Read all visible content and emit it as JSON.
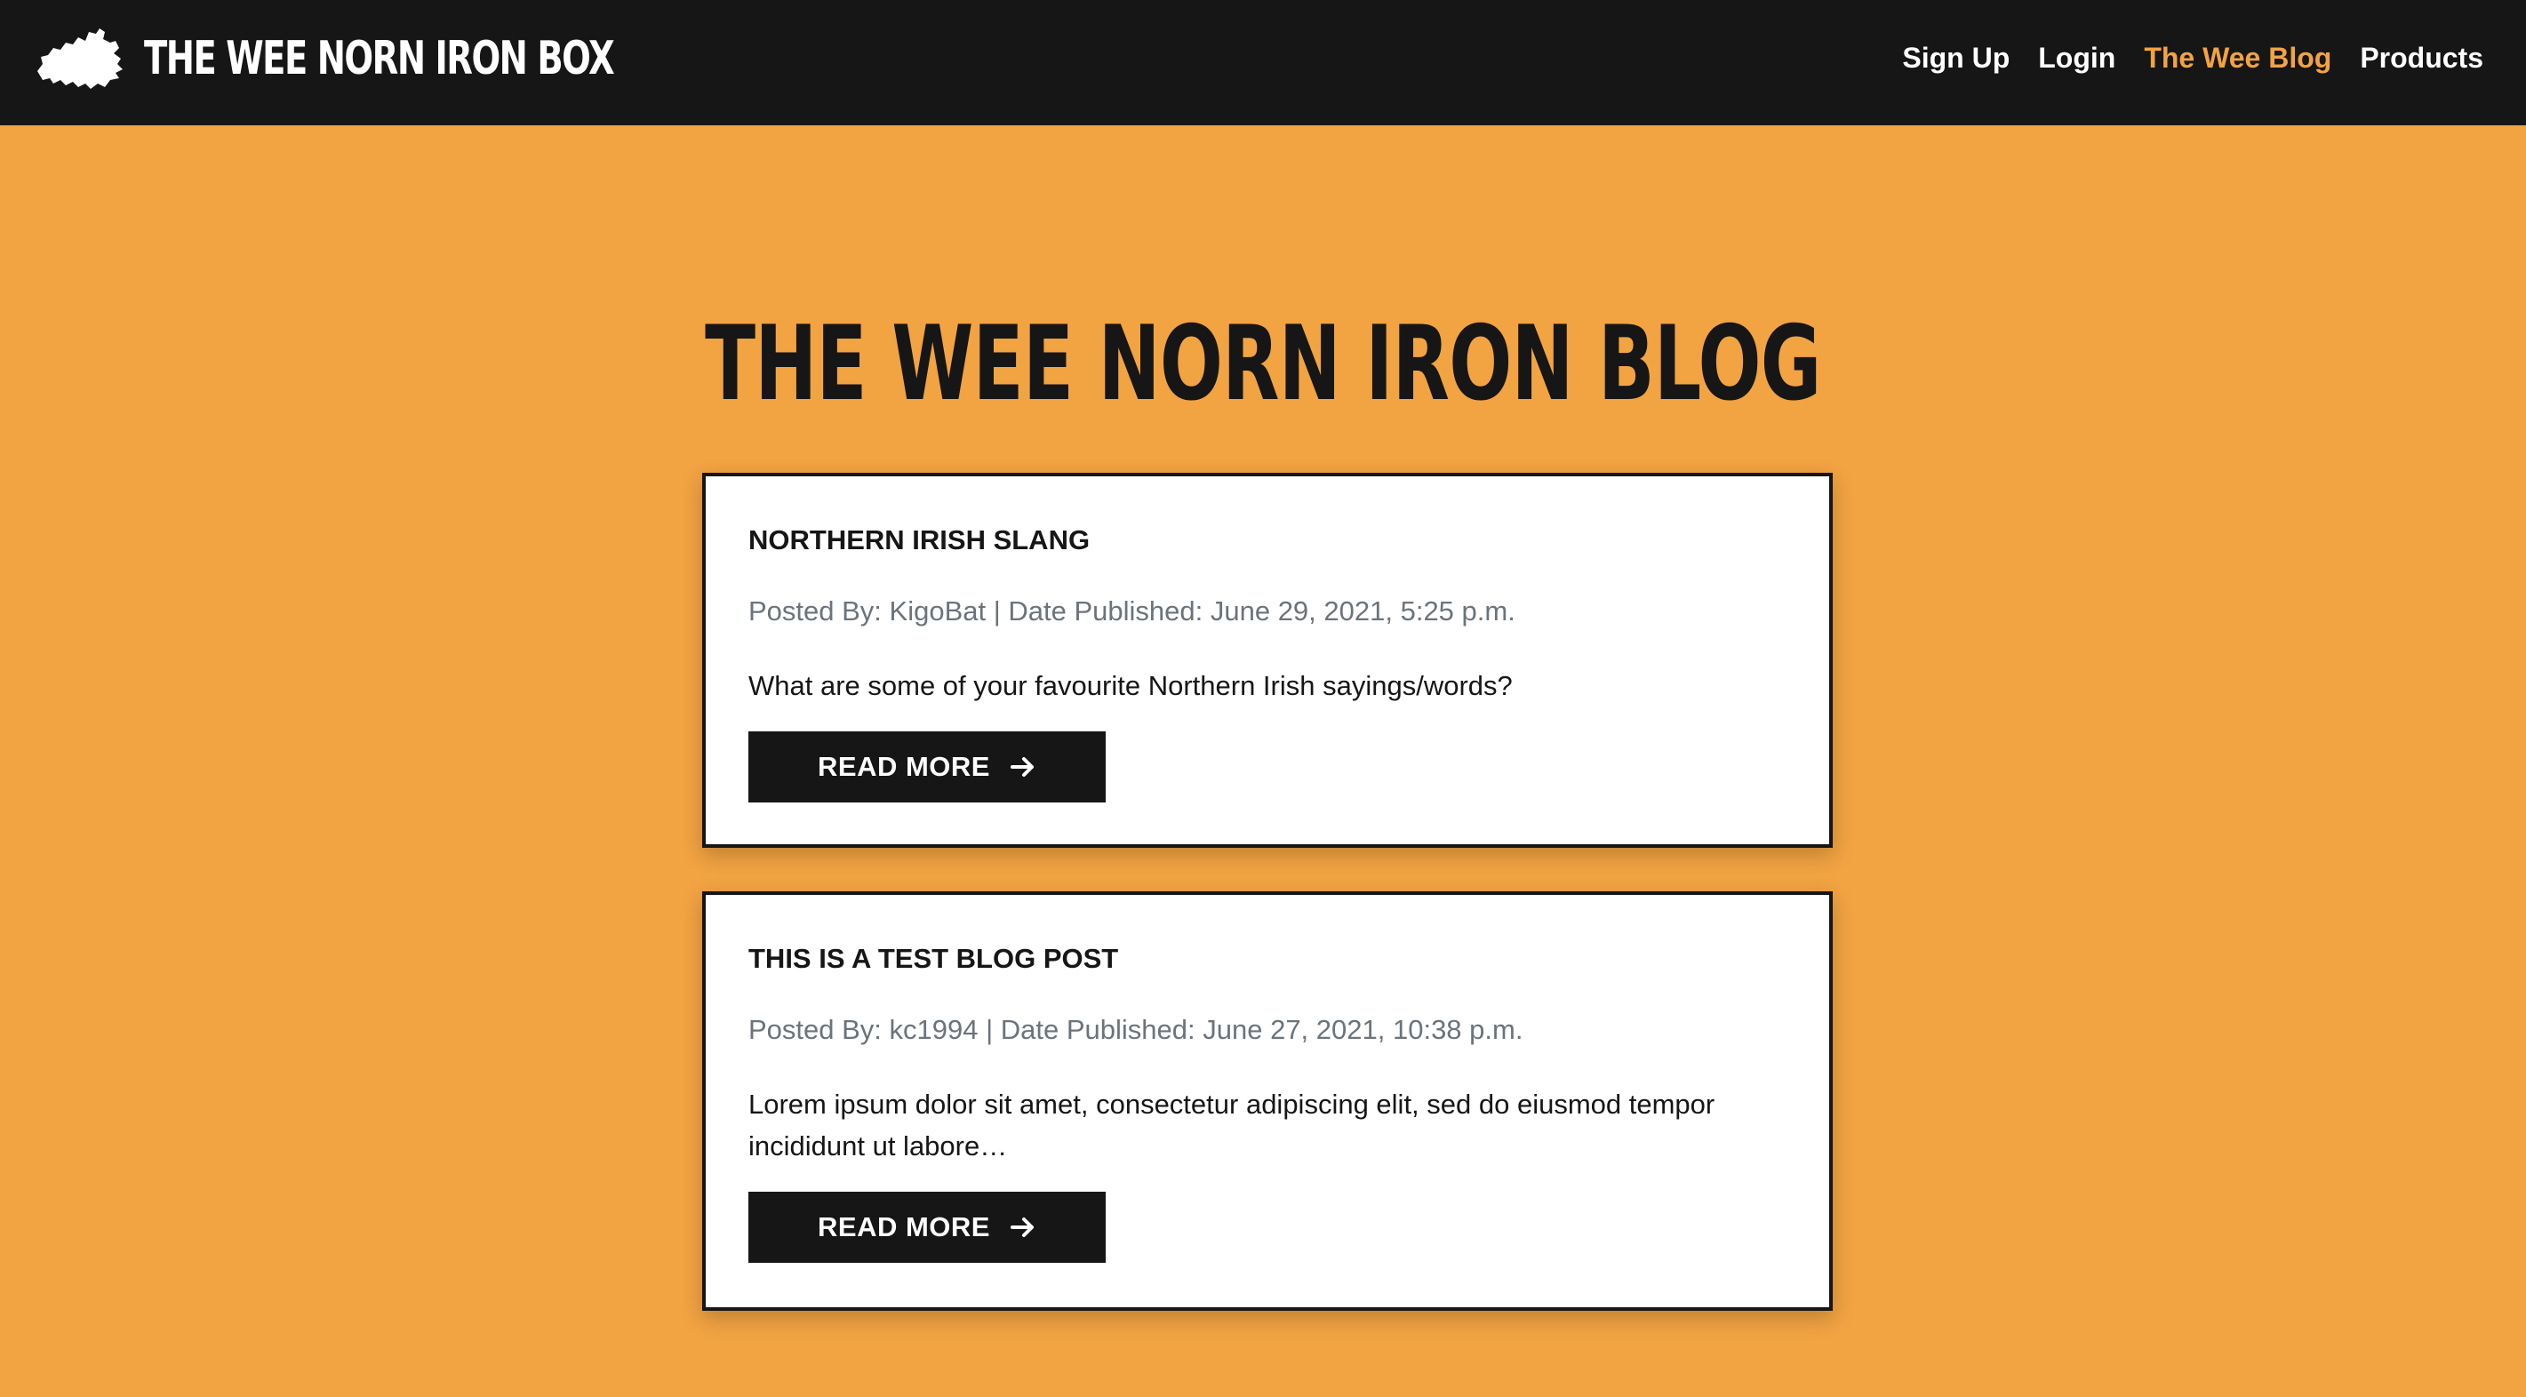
{
  "navbar": {
    "brand": "THE WEE NORN IRON BOX",
    "logo_icon": "northern-ireland-map-icon",
    "links": [
      {
        "label": "Sign Up",
        "active": false
      },
      {
        "label": "Login",
        "active": false
      },
      {
        "label": "The Wee Blog",
        "active": true
      },
      {
        "label": "Products",
        "active": false
      }
    ]
  },
  "page": {
    "title": "THE WEE NORN IRON BLOG"
  },
  "posts": [
    {
      "title": "NORTHERN IRISH SLANG",
      "meta": "Posted By: KigoBat | Date Published: June 29, 2021, 5:25 p.m.",
      "excerpt": "What are some of your favourite Northern Irish sayings/words?",
      "button_label": "READ MORE",
      "button_icon": "arrow-right-icon"
    },
    {
      "title": "THIS IS A TEST BLOG POST",
      "meta": "Posted By: kc1994 | Date Published: June 27, 2021, 10:38 p.m.",
      "excerpt": "Lorem ipsum dolor sit amet, consectetur adipiscing elit, sed do eiusmod tempor incididunt ut labore…",
      "button_label": "READ MORE",
      "button_icon": "arrow-right-icon"
    }
  ],
  "colors": {
    "accent": "#f2a342",
    "dark": "#161616",
    "meta_text": "#6b737b",
    "card_bg": "#ffffff"
  }
}
